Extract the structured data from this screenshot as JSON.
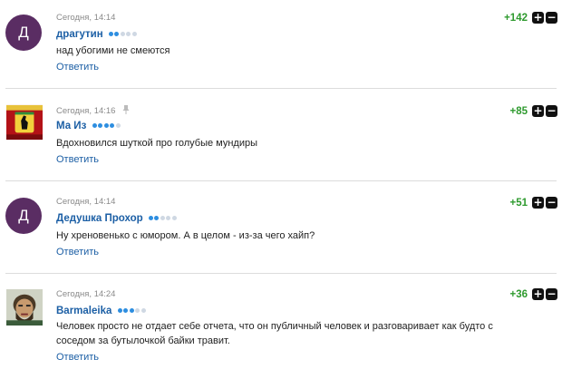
{
  "comments": [
    {
      "avatar_letter": "Д",
      "avatar_color": "#5a2d63",
      "time": "Сегодня, 14:14",
      "author": "драгутин",
      "rank": 2,
      "text": "над убогими не смеются",
      "reply_label": "Ответить",
      "score": "+142",
      "upvote_icon": "plus-icon",
      "downvote_icon": "minus-icon"
    },
    {
      "avatar_letter": "",
      "avatar_image": "ferrari-logo-avatar",
      "time": "Сегодня, 14:16",
      "pin_icon": "pin-icon",
      "author": "Ма Из",
      "rank": 4,
      "text": "Вдохновился шуткой про голубые мундиры",
      "reply_label": "Ответить",
      "score": "+85",
      "upvote_icon": "plus-icon",
      "downvote_icon": "minus-icon"
    },
    {
      "avatar_letter": "Д",
      "avatar_color": "#5a2d63",
      "time": "Сегодня, 14:14",
      "author": "Дедушка Прохор",
      "rank": 2,
      "text": "Ну хреновенько с юмором. А в целом - из-за чего хайп?",
      "reply_label": "Ответить",
      "score": "+51",
      "upvote_icon": "plus-icon",
      "downvote_icon": "minus-icon"
    },
    {
      "avatar_letter": "",
      "avatar_image": "man-with-beard-avatar",
      "time": "Сегодня, 14:24",
      "author": "Barmaleika",
      "rank": 3,
      "text": "Человек просто не отдает себе отчета, что он публичный человек и разговаривает как будто с соседом за бутылочкой байки травит.",
      "reply_label": "Ответить",
      "score": "+36",
      "upvote_icon": "plus-icon",
      "downvote_icon": "minus-icon"
    }
  ],
  "rank_max": 5,
  "colors": {
    "author_link": "#1c5fa5",
    "score_positive": "#2e9a2e",
    "rank_active": "#2d8ee0",
    "rank_inactive": "#cfd8e3"
  }
}
